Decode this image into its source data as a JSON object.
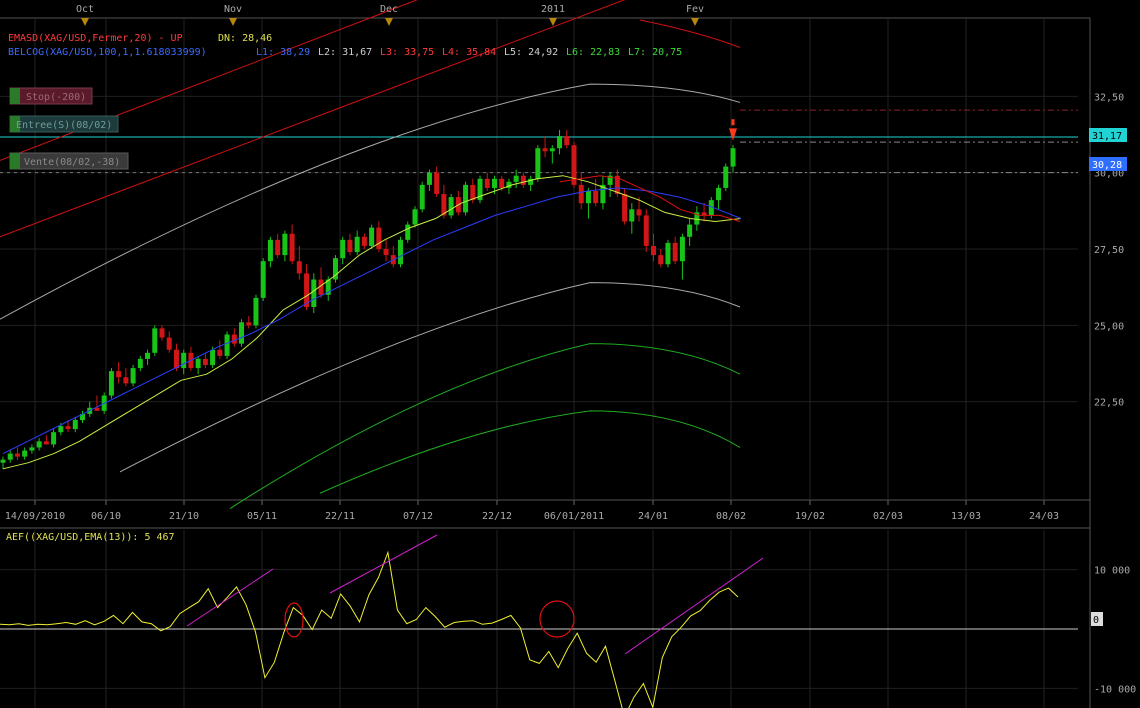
{
  "top_months": [
    "Oct",
    "Nov",
    "Dec",
    "2011",
    "Fev"
  ],
  "legend": {
    "ema_line": "EMASD(XAG/USD,Fermer,20) - UP",
    "ema_dn": "DN: 28,46",
    "bel_prefix": "BELCOG(XAG/USD,100,1,1.618033999)",
    "bel_levels": [
      "L1: 38,29",
      "L2: 31,67",
      "L3: 33,75",
      "L4: 35,84",
      "L5: 24,92",
      "L6: 22,83",
      "L7: 20,75"
    ]
  },
  "order_labels": [
    "Stop(-200)",
    "Entree(S)(08/02)",
    "Vente(08/02,-38)"
  ],
  "price_tags": [
    "31,17",
    "30,28"
  ],
  "osc_title": "AEF((XAG/USD,EMA(13)): 5 467",
  "osc_zero_tag": "0",
  "chart_data": {
    "type": "candlestick",
    "title": "XAG/USD",
    "ylim": [
      20.0,
      35.0
    ],
    "y_ticks": [
      "32,50",
      "30,00",
      "27,50",
      "25,00",
      "22,50"
    ],
    "x_labels": [
      "14/09/2010",
      "06/10",
      "21/10",
      "05/11",
      "22/11",
      "07/12",
      "22/12",
      "06/01/2011",
      "24/01",
      "08/02",
      "19/02",
      "02/03",
      "13/03",
      "24/03"
    ],
    "candles": [
      [
        20.5,
        20.7,
        20.3,
        20.6
      ],
      [
        20.6,
        20.9,
        20.5,
        20.8
      ],
      [
        20.8,
        21.0,
        20.6,
        20.7
      ],
      [
        20.7,
        21.0,
        20.6,
        20.9
      ],
      [
        20.9,
        21.1,
        20.8,
        21.0
      ],
      [
        21.0,
        21.3,
        20.9,
        21.2
      ],
      [
        21.2,
        21.4,
        21.1,
        21.1
      ],
      [
        21.1,
        21.6,
        21.0,
        21.5
      ],
      [
        21.5,
        21.8,
        21.4,
        21.7
      ],
      [
        21.7,
        21.9,
        21.5,
        21.6
      ],
      [
        21.6,
        22.0,
        21.5,
        21.9
      ],
      [
        21.9,
        22.2,
        21.8,
        22.1
      ],
      [
        22.1,
        22.5,
        22.0,
        22.3
      ],
      [
        22.3,
        22.7,
        22.2,
        22.2
      ],
      [
        22.2,
        22.8,
        22.1,
        22.7
      ],
      [
        22.7,
        23.6,
        22.6,
        23.5
      ],
      [
        23.5,
        23.8,
        23.1,
        23.3
      ],
      [
        23.3,
        23.6,
        23.0,
        23.1
      ],
      [
        23.1,
        23.7,
        23.0,
        23.6
      ],
      [
        23.6,
        24.0,
        23.5,
        23.9
      ],
      [
        23.9,
        24.2,
        23.7,
        24.1
      ],
      [
        24.1,
        25.0,
        24.0,
        24.9
      ],
      [
        24.9,
        25.0,
        24.5,
        24.6
      ],
      [
        24.6,
        24.8,
        24.1,
        24.2
      ],
      [
        24.2,
        24.4,
        23.5,
        23.6
      ],
      [
        23.6,
        24.2,
        23.4,
        24.1
      ],
      [
        24.1,
        24.3,
        23.5,
        23.6
      ],
      [
        23.6,
        24.0,
        23.4,
        23.9
      ],
      [
        23.9,
        24.1,
        23.6,
        23.7
      ],
      [
        23.7,
        24.3,
        23.6,
        24.2
      ],
      [
        24.2,
        24.5,
        23.9,
        24.0
      ],
      [
        24.0,
        24.8,
        23.9,
        24.7
      ],
      [
        24.7,
        24.9,
        24.3,
        24.4
      ],
      [
        24.4,
        25.2,
        24.3,
        25.1
      ],
      [
        25.1,
        25.3,
        24.9,
        25.0
      ],
      [
        25.0,
        26.0,
        24.9,
        25.9
      ],
      [
        25.9,
        27.2,
        25.8,
        27.1
      ],
      [
        27.1,
        27.9,
        26.9,
        27.8
      ],
      [
        27.8,
        28.0,
        27.2,
        27.3
      ],
      [
        27.3,
        28.1,
        27.1,
        28.0
      ],
      [
        28.0,
        28.3,
        27.0,
        27.1
      ],
      [
        27.1,
        27.6,
        26.5,
        26.7
      ],
      [
        26.7,
        27.0,
        25.5,
        25.6
      ],
      [
        25.6,
        26.7,
        25.4,
        26.5
      ],
      [
        26.5,
        26.9,
        25.9,
        26.0
      ],
      [
        26.0,
        26.6,
        25.8,
        26.5
      ],
      [
        26.5,
        27.3,
        26.4,
        27.2
      ],
      [
        27.2,
        27.9,
        27.0,
        27.8
      ],
      [
        27.8,
        28.0,
        27.3,
        27.4
      ],
      [
        27.4,
        28.1,
        27.3,
        27.9
      ],
      [
        27.9,
        28.0,
        27.5,
        27.6
      ],
      [
        27.6,
        28.3,
        27.5,
        28.2
      ],
      [
        28.2,
        28.4,
        27.4,
        27.5
      ],
      [
        27.5,
        27.8,
        27.1,
        27.3
      ],
      [
        27.3,
        27.6,
        26.9,
        27.0
      ],
      [
        27.0,
        27.9,
        26.9,
        27.8
      ],
      [
        27.8,
        28.4,
        27.7,
        28.3
      ],
      [
        28.3,
        28.9,
        28.2,
        28.8
      ],
      [
        28.8,
        29.7,
        28.7,
        29.6
      ],
      [
        29.6,
        30.1,
        29.4,
        30.0
      ],
      [
        30.0,
        30.2,
        29.2,
        29.3
      ],
      [
        29.3,
        29.6,
        28.5,
        28.6
      ],
      [
        28.6,
        29.3,
        28.5,
        29.2
      ],
      [
        29.2,
        29.4,
        28.6,
        28.7
      ],
      [
        28.7,
        29.7,
        28.6,
        29.6
      ],
      [
        29.6,
        29.8,
        29.0,
        29.1
      ],
      [
        29.1,
        29.9,
        29.0,
        29.8
      ],
      [
        29.8,
        30.0,
        29.4,
        29.5
      ],
      [
        29.5,
        29.9,
        29.3,
        29.8
      ],
      [
        29.8,
        29.9,
        29.4,
        29.5
      ],
      [
        29.5,
        29.8,
        29.3,
        29.7
      ],
      [
        29.7,
        30.1,
        29.5,
        29.9
      ],
      [
        29.9,
        30.0,
        29.5,
        29.6
      ],
      [
        29.6,
        29.9,
        29.4,
        29.8
      ],
      [
        29.8,
        30.9,
        29.7,
        30.8
      ],
      [
        30.8,
        31.2,
        30.5,
        30.7
      ],
      [
        30.7,
        30.9,
        30.3,
        30.8
      ],
      [
        30.8,
        31.4,
        30.6,
        31.2
      ],
      [
        31.2,
        31.4,
        30.8,
        30.9
      ],
      [
        30.9,
        31.0,
        29.5,
        29.6
      ],
      [
        29.6,
        30.0,
        28.8,
        29.0
      ],
      [
        29.0,
        29.5,
        28.5,
        29.4
      ],
      [
        29.4,
        29.8,
        28.9,
        29.0
      ],
      [
        29.0,
        29.9,
        28.8,
        29.6
      ],
      [
        29.6,
        30.0,
        29.2,
        29.9
      ],
      [
        29.9,
        30.1,
        29.2,
        29.3
      ],
      [
        29.3,
        29.5,
        28.3,
        28.4
      ],
      [
        28.4,
        29.0,
        28.0,
        28.8
      ],
      [
        28.8,
        29.2,
        28.4,
        28.6
      ],
      [
        28.6,
        28.8,
        27.4,
        27.6
      ],
      [
        27.6,
        28.0,
        27.1,
        27.3
      ],
      [
        27.3,
        27.5,
        26.9,
        27.0
      ],
      [
        27.0,
        27.8,
        26.9,
        27.7
      ],
      [
        27.7,
        27.9,
        27.0,
        27.1
      ],
      [
        27.1,
        28.0,
        26.5,
        27.9
      ],
      [
        27.9,
        28.5,
        27.6,
        28.3
      ],
      [
        28.3,
        28.9,
        28.1,
        28.7
      ],
      [
        28.7,
        29.0,
        28.4,
        28.6
      ],
      [
        28.6,
        29.2,
        28.5,
        29.1
      ],
      [
        29.1,
        29.6,
        28.8,
        29.5
      ],
      [
        29.5,
        30.3,
        29.4,
        30.2
      ],
      [
        30.2,
        30.9,
        30.0,
        30.8
      ]
    ],
    "series": [
      {
        "name": "EMASD",
        "values": [
          20.3,
          20.5,
          20.8,
          21.2,
          21.7,
          22.2,
          22.7,
          23.2,
          23.4,
          23.9,
          24.6,
          25.5,
          26.0,
          26.6,
          27.3,
          27.8,
          28.2,
          28.5,
          29.0,
          29.3,
          29.6,
          29.8,
          29.9,
          29.7,
          29.4,
          29.1,
          28.7,
          28.5,
          28.4,
          28.5
        ]
      },
      {
        "name": "BELCOG",
        "values": [
          20.8,
          21.3,
          21.8,
          22.3,
          22.8,
          23.3,
          23.8,
          24.3,
          24.7,
          25.2,
          25.8,
          26.3,
          26.8,
          27.3,
          27.8,
          28.2,
          28.6,
          28.9,
          29.2,
          29.4,
          29.5,
          29.4,
          29.2,
          28.9,
          28.5
        ]
      }
    ],
    "oscillator": {
      "name": "AEF((XAG/USD,EMA(13))",
      "ylim": [
        -15000,
        15000
      ],
      "y_ticks": [
        "10 000",
        "0",
        "-10 000"
      ],
      "values": [
        800,
        700,
        900,
        600,
        800,
        700,
        900,
        1100,
        800,
        1400,
        700,
        1300,
        2300,
        900,
        2800,
        1200,
        900,
        -300,
        400,
        2600,
        3600,
        4600,
        6800,
        3600,
        5300,
        7100,
        4100,
        -500,
        -8200,
        -5600,
        -600,
        3600,
        2300,
        -100,
        3200,
        1800,
        5900,
        3900,
        1200,
        5800,
        8700,
        12900,
        3200,
        900,
        1600,
        3600,
        2100,
        300,
        1100,
        1300,
        1400,
        800,
        1000,
        1600,
        2300,
        200,
        -5200,
        -5800,
        -3800,
        -6500,
        -3300,
        -700,
        -4100,
        -5600,
        -2900,
        -8800,
        -14800,
        -11500,
        -9200,
        -13200,
        -4800,
        -1300,
        300,
        2200,
        3100,
        4800,
        6200,
        6900,
        5400
      ]
    }
  }
}
